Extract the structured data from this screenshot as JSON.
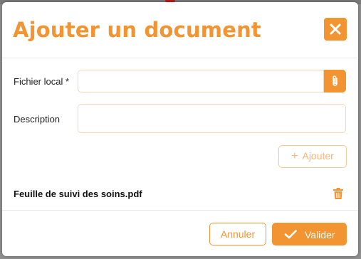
{
  "dialog": {
    "title": "Ajouter un document",
    "close_icon": "close-icon"
  },
  "form": {
    "local_file_label": "Fichier local *",
    "local_file_value": "",
    "attach_icon": "paperclip-icon",
    "description_label": "Description",
    "description_value": "",
    "add_button_label": "Ajouter",
    "add_icon": "plus-icon"
  },
  "files": [
    {
      "name": "Feuille de suivi des soins.pdf",
      "action_icon": "trash-icon"
    }
  ],
  "footer": {
    "cancel_label": "Annuler",
    "submit_label": "Valider",
    "submit_icon": "check-icon"
  },
  "colors": {
    "accent": "#f39433",
    "accent_light": "#f7c99a",
    "backdrop": "#8f8f8f"
  }
}
